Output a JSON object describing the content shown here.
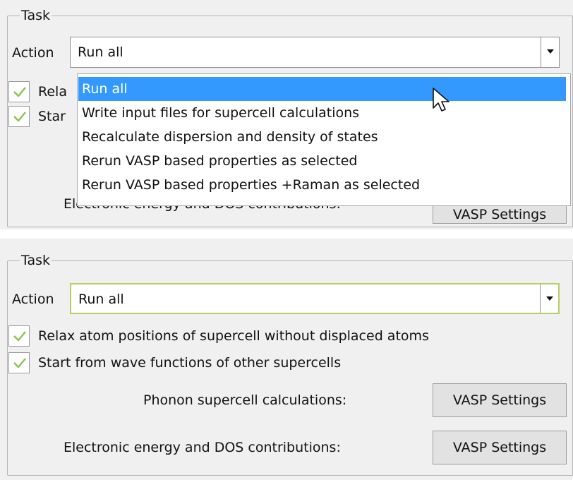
{
  "panel_top": {
    "group_title": "Task",
    "action_label": "Action",
    "action_value": "Run all",
    "checkbox1_label_partial": "Rela",
    "checkbox2_label_partial": "Star",
    "row2_label_partial": "Electronic energy and DOS contributions:",
    "button2_label_partial": "VASP Settings",
    "dropdown_options": [
      "Run all",
      "Write input files for supercell calculations",
      "Recalculate dispersion and density of states",
      "Rerun VASP based properties as selected",
      "Rerun VASP based properties +Raman as selected"
    ],
    "selected_index": 0
  },
  "panel_bottom": {
    "group_title": "Task",
    "action_label": "Action",
    "action_value": "Run all",
    "checkbox1_label": "Relax atom positions of supercell without displaced atoms",
    "checkbox1_checked": true,
    "checkbox2_label": "Start from wave functions of other supercells",
    "checkbox2_checked": true,
    "row1_label": "Phonon supercell calculations:",
    "row1_button": "VASP Settings",
    "row2_label": "Electronic energy and DOS contributions:",
    "row2_button": "VASP Settings"
  },
  "colors": {
    "check_green": "#8bc34a",
    "focus_border": "#b5cf64",
    "selection_blue": "#3399ff"
  },
  "icons": {
    "checkmark": "checkmark-icon",
    "dropdown_arrow": "chevron-down-icon",
    "cursor": "mouse-pointer-icon"
  }
}
